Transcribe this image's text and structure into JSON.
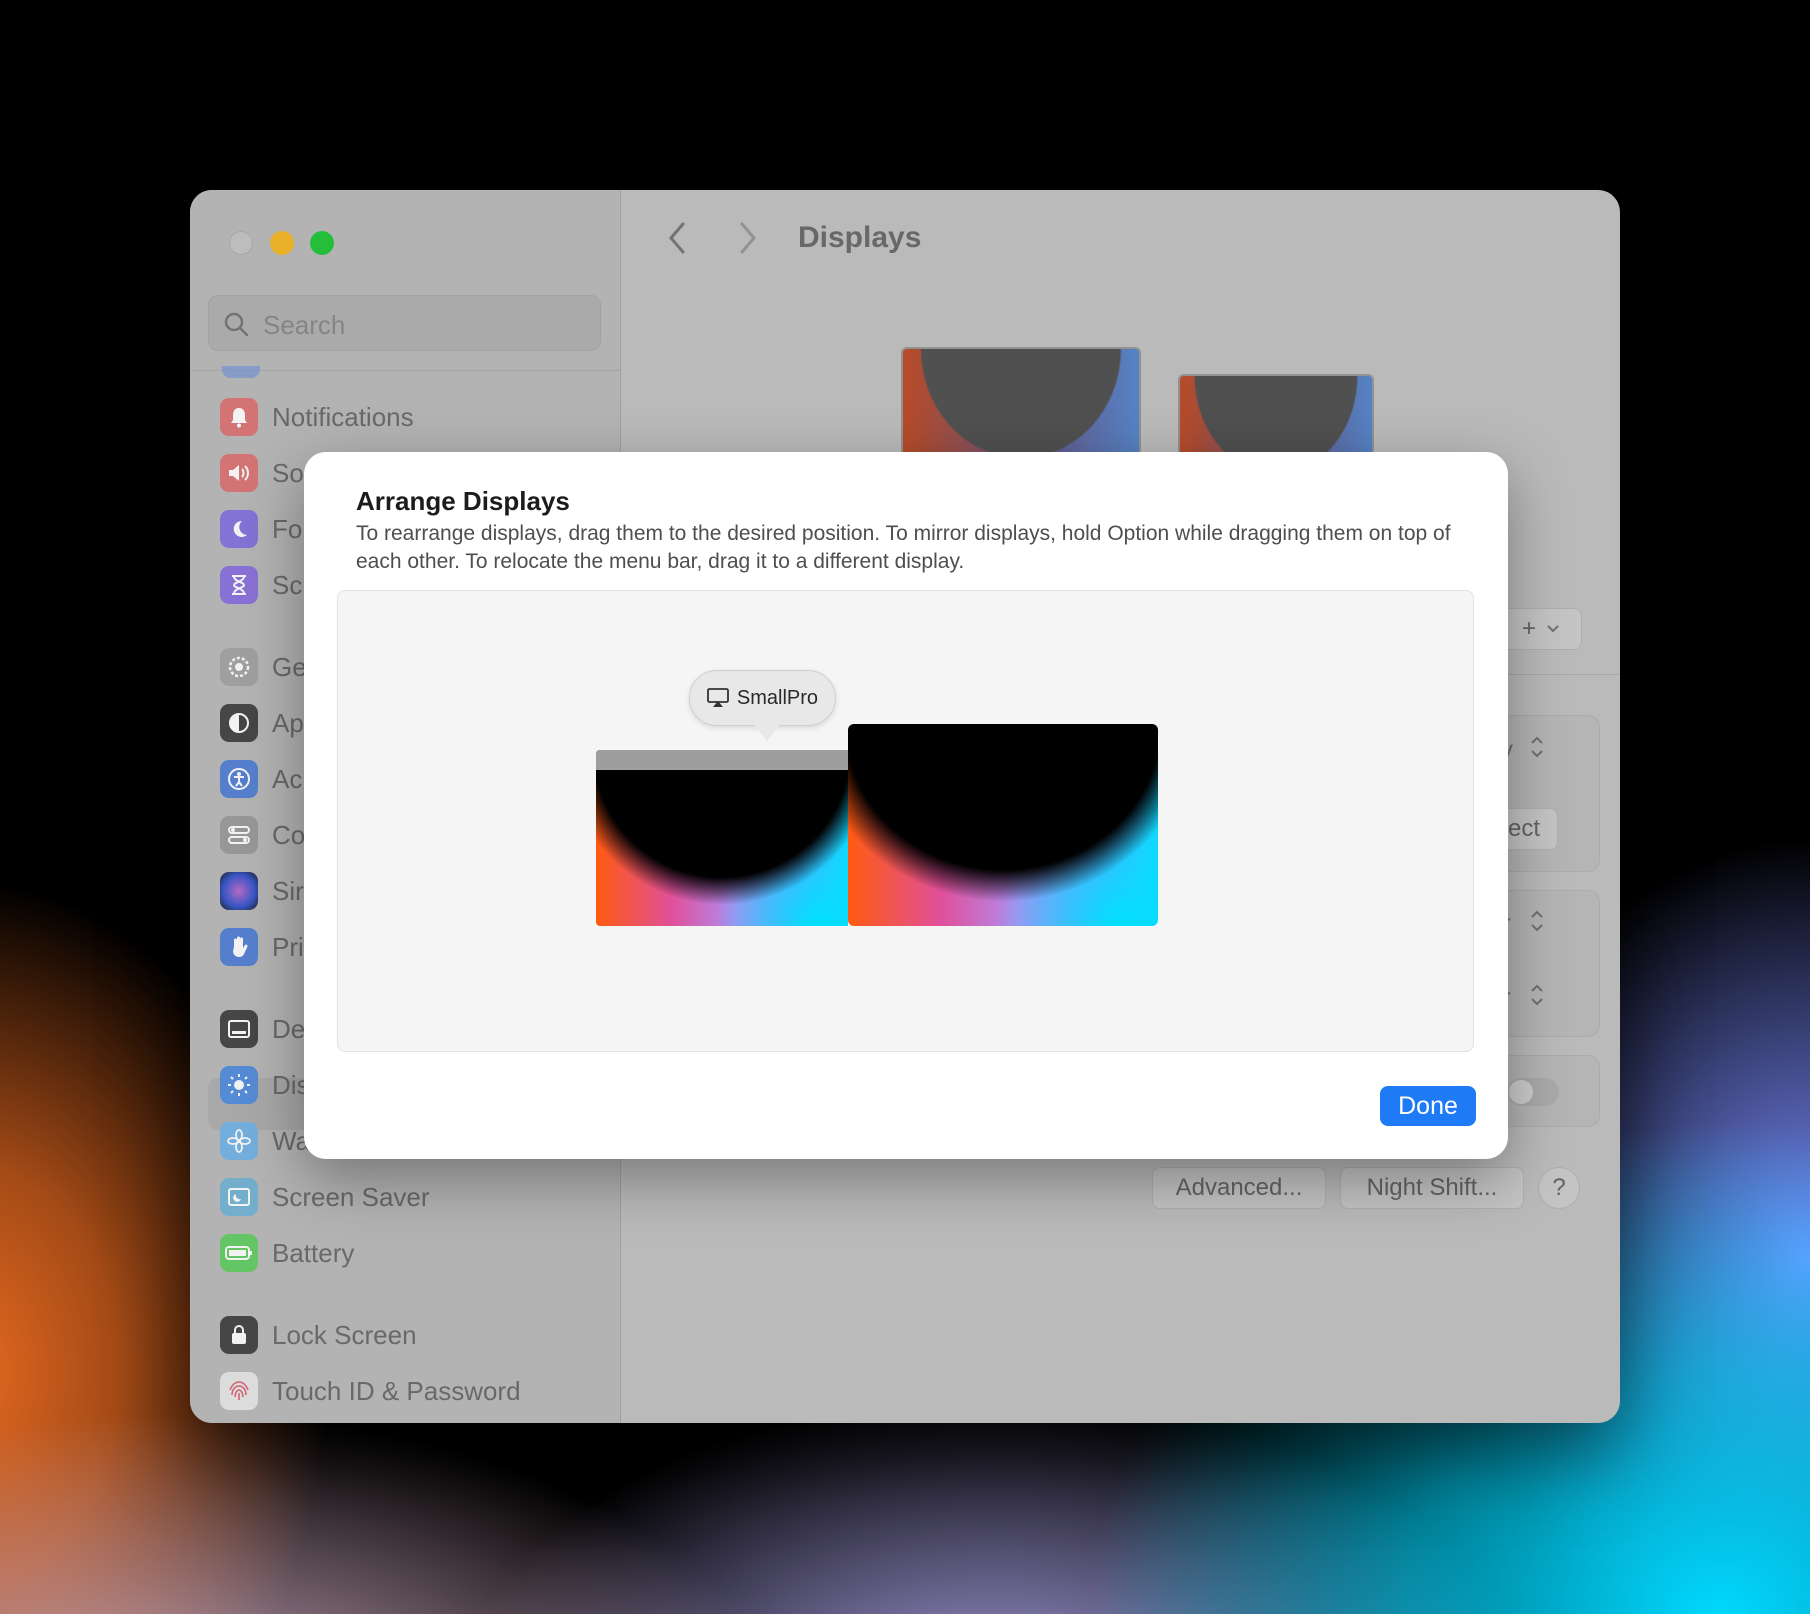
{
  "window": {
    "title": "Displays"
  },
  "sidebar": {
    "search_placeholder": "Search",
    "items": [
      {
        "label": "Notifications",
        "icon": "bell-icon",
        "color": "#e06a6a"
      },
      {
        "label": "So",
        "icon": "speaker-icon",
        "color": "#e06a6a"
      },
      {
        "label": "Fo",
        "icon": "moon-icon",
        "color": "#7c6ad8"
      },
      {
        "label": "Sc",
        "icon": "hourglass-icon",
        "color": "#8a6ad8"
      },
      {
        "label": "Ge",
        "icon": "gear-icon",
        "color": "#9a9a9a"
      },
      {
        "label": "Ap",
        "icon": "appearance-icon",
        "color": "#3a3a3a"
      },
      {
        "label": "Ac",
        "icon": "accessibility-icon",
        "color": "#4a7ad8"
      },
      {
        "label": "Co",
        "icon": "control-center-icon",
        "color": "#9a9a9a"
      },
      {
        "label": "Sir",
        "icon": "siri-icon",
        "color": "#8a5ab8"
      },
      {
        "label": "Pri",
        "icon": "hand-icon",
        "color": "#4a7ad8"
      },
      {
        "label": "De",
        "icon": "desktop-dock-icon",
        "color": "#3a3a3a"
      },
      {
        "label": "Dis",
        "icon": "brightness-icon",
        "color": "#4a8ae0"
      },
      {
        "label": "Wallpaper",
        "icon": "flower-icon",
        "color": "#6ab0e0"
      },
      {
        "label": "Screen Saver",
        "icon": "screen-saver-icon",
        "color": "#6ab0d0"
      },
      {
        "label": "Battery",
        "icon": "battery-icon",
        "color": "#5ac85a"
      },
      {
        "label": "Lock Screen",
        "icon": "lock-icon",
        "color": "#3a3a3a"
      },
      {
        "label": "Touch ID & Password",
        "icon": "fingerprint-icon",
        "color": "#e0e0e0"
      }
    ]
  },
  "main": {
    "partial_labels": [
      "y",
      "ect",
      "r",
      "r"
    ],
    "advanced_label": "Advanced...",
    "night_shift_label": "Night Shift...",
    "help_label": "?",
    "add_label": "+"
  },
  "sheet": {
    "title": "Arrange Displays",
    "description": "To rearrange displays, drag them to the desired position. To mirror displays, hold Option while dragging them on top of each other. To relocate the menu bar, drag it to a different display.",
    "tooltip_label": "SmallPro",
    "done_label": "Done",
    "accent_color": "#1f7bf5"
  }
}
